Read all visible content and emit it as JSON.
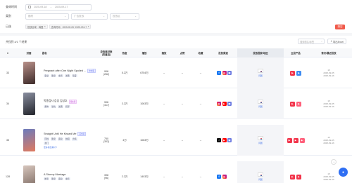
{
  "filters": {
    "date_label": "查询时间",
    "date_start": "2025-09-18",
    "date_end": "2025-09-17",
    "category_label": "类别",
    "category_placeholder": "题材",
    "platform_placeholder": "广告投放",
    "region_placeholder": "投放区",
    "selected_label": "已选",
    "selected_tags": [
      "投放区域：韩国",
      "查询时间：2025-09-05~2025-09-17"
    ],
    "clear_label": "清空"
  },
  "result_count": "共找到 4/1 个结果",
  "search_placeholder": "搜索剧名/标签",
  "export_label": "导出Excel",
  "columns": [
    "#",
    "封面",
    "剧名",
    "投放素材数 (去重后)",
    "热度",
    "播放",
    "播放",
    "点赞",
    "收藏",
    "投放渠道",
    "投放国家/地区",
    "主投产品",
    "首次/最近投放"
  ],
  "rows": [
    {
      "index": "33",
      "cover_colors": [
        "#b9918a",
        "#3d2b2a"
      ],
      "title": "Pregnant after One Night Spoiled ...",
      "tag": "中文版",
      "tag_style": "blue",
      "genres": [
        "霸总",
        "甜宠",
        "虐恋",
        "逆袭",
        "萌宝"
      ],
      "more": "",
      "materials": "906",
      "materials_sub": "(262)",
      "heat": "5.2万",
      "plays": "6754万",
      "col6": "--",
      "likes": "--",
      "favorites": "--",
      "channels": [
        "fb",
        "ig",
        "mt"
      ],
      "region": "韩国",
      "products": [
        "red",
        "blue"
      ],
      "first_date": "15",
      "first_date_full": "2025-09-05",
      "last_date": "2025-09-16"
    },
    {
      "index": "34",
      "cover_colors": [
        "#8a8fa0",
        "#23252c"
      ],
      "title": "독종검사 김성 김성호",
      "tag": "韩文版",
      "tag_style": "pink",
      "genres": [
        "都市",
        "复仇",
        "逆袭",
        "犯罪"
      ],
      "more": "",
      "materials": "906",
      "materials_sub": "(417)",
      "heat": "3.2万",
      "plays": "1063万",
      "col6": "--",
      "likes": "--",
      "favorites": "--",
      "channels": [
        "ig",
        "yt",
        "mt"
      ],
      "region": "韩国",
      "products": [
        "red",
        "pink"
      ],
      "first_date": "15",
      "first_date_full": "2025-09-05",
      "last_date": "2025-09-16"
    },
    {
      "index": "35",
      "cover_colors": [
        "#6b7bbd",
        "#e07a5f"
      ],
      "title": "Straight Until He Kissed Me",
      "tag": "英文版",
      "tag_style": "blue",
      "genres": [
        "同性",
        "甜宠",
        "霸总",
        "校园",
        "言情",
        "豪门"
      ],
      "more": "更多投放素材 7",
      "materials": "750",
      "materials_sub": "(302)",
      "heat": "4万",
      "plays": "1063万",
      "col6": "--",
      "likes": "--",
      "favorites": "--",
      "channels": [
        "tk",
        "yt",
        "mt"
      ],
      "region": "韩国",
      "products": [
        "red",
        "red",
        "pink"
      ],
      "first_date": "15",
      "first_date_full": "2025-09-05",
      "last_date": "2025-09-16"
    },
    {
      "index": "128",
      "cover_colors": [
        "#d7c6bd",
        "#7c6a62"
      ],
      "title": "A Stormy Marriage",
      "tag": "",
      "tag_style": "blue",
      "genres": [
        "婚恋",
        "甜宠",
        "霸总",
        "虐恋"
      ],
      "more": "",
      "materials": "398",
      "materials_sub": "(96)",
      "heat": "2.2万",
      "plays": "1403万",
      "col6": "--",
      "likes": "--",
      "favorites": "--",
      "channels": [
        "fb",
        "ig"
      ],
      "region": "韩国",
      "products": [
        "red",
        "red"
      ],
      "first_date": "15",
      "first_date_full": "2025-09-05",
      "last_date": "2025-09-16"
    }
  ]
}
